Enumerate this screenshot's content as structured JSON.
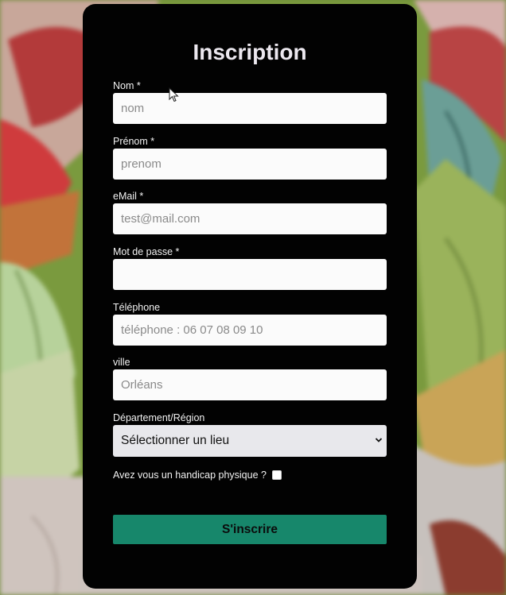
{
  "form": {
    "title": "Inscription",
    "fields": [
      {
        "label": "Nom *",
        "placeholder": "nom",
        "value": ""
      },
      {
        "label": "Prénom *",
        "placeholder": "prenom",
        "value": ""
      },
      {
        "label": "eMail *",
        "placeholder": "test@mail.com",
        "value": ""
      },
      {
        "label": "Mot de passe *",
        "placeholder": "",
        "value": ""
      },
      {
        "label": "Téléphone",
        "placeholder": "téléphone : 06 07 08 09 10",
        "value": ""
      },
      {
        "label": "ville",
        "placeholder": "Orléans",
        "value": ""
      }
    ],
    "region": {
      "label": "Département/Région",
      "selected": "Sélectionner un lieu"
    },
    "handicap": {
      "label": "Avez vous un handicap physique ?",
      "checked": false
    },
    "submit_label": "S'inscrire"
  },
  "colors": {
    "card": "#020202",
    "accent": "#17876b",
    "title": "#ece8ef",
    "input_bg": "#fbfbfb"
  },
  "icons": {
    "select": "chevron-down-icon",
    "pointer": "mouse-cursor-icon"
  }
}
